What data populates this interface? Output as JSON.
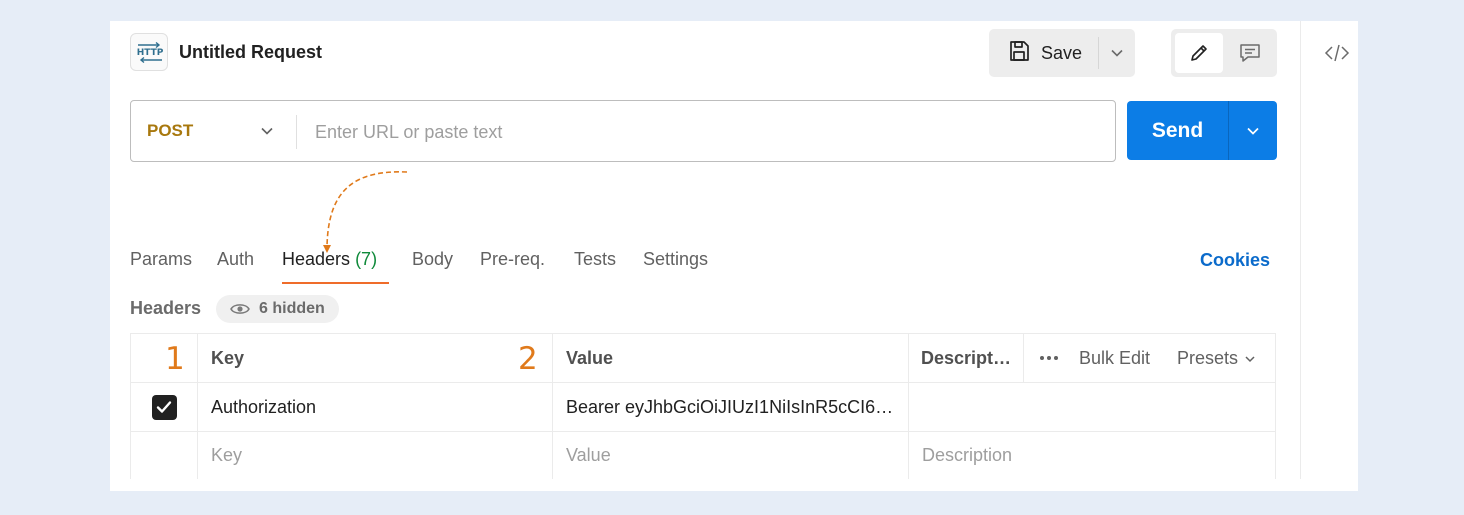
{
  "request": {
    "title": "Untitled Request"
  },
  "toolbar": {
    "save_label": "Save"
  },
  "url_bar": {
    "method": "POST",
    "placeholder": "Enter URL or paste text",
    "value": "",
    "send_label": "Send"
  },
  "tabs": [
    {
      "label": "Params",
      "count": ""
    },
    {
      "label": "Auth",
      "count": ""
    },
    {
      "label": "Headers",
      "count": "(7)"
    },
    {
      "label": "Body",
      "count": ""
    },
    {
      "label": "Pre-req.",
      "count": ""
    },
    {
      "label": "Tests",
      "count": ""
    },
    {
      "label": "Settings",
      "count": ""
    }
  ],
  "active_tab": "Headers",
  "cookies_label": "Cookies",
  "headers_section": {
    "label": "Headers",
    "hidden_label": "6 hidden",
    "columns": {
      "key": "Key",
      "value": "Value",
      "description": "Descript…"
    },
    "bulk_edit_label": "Bulk Edit",
    "presets_label": "Presets",
    "markers": [
      "1",
      "2"
    ],
    "rows": [
      {
        "checked": true,
        "key": "Authorization",
        "value": "Bearer eyJhbGciOiJIUzI1NiIsInR5cCI6…",
        "description": ""
      }
    ],
    "empty_row": {
      "key_placeholder": "Key",
      "value_placeholder": "Value",
      "description_placeholder": "Description"
    }
  },
  "colors": {
    "accent": "#0C7DE6",
    "method": "#A8780E",
    "active_tab_underline": "#EF6C2A",
    "count": "#0F8A3A",
    "marker": "#E07A1B"
  }
}
